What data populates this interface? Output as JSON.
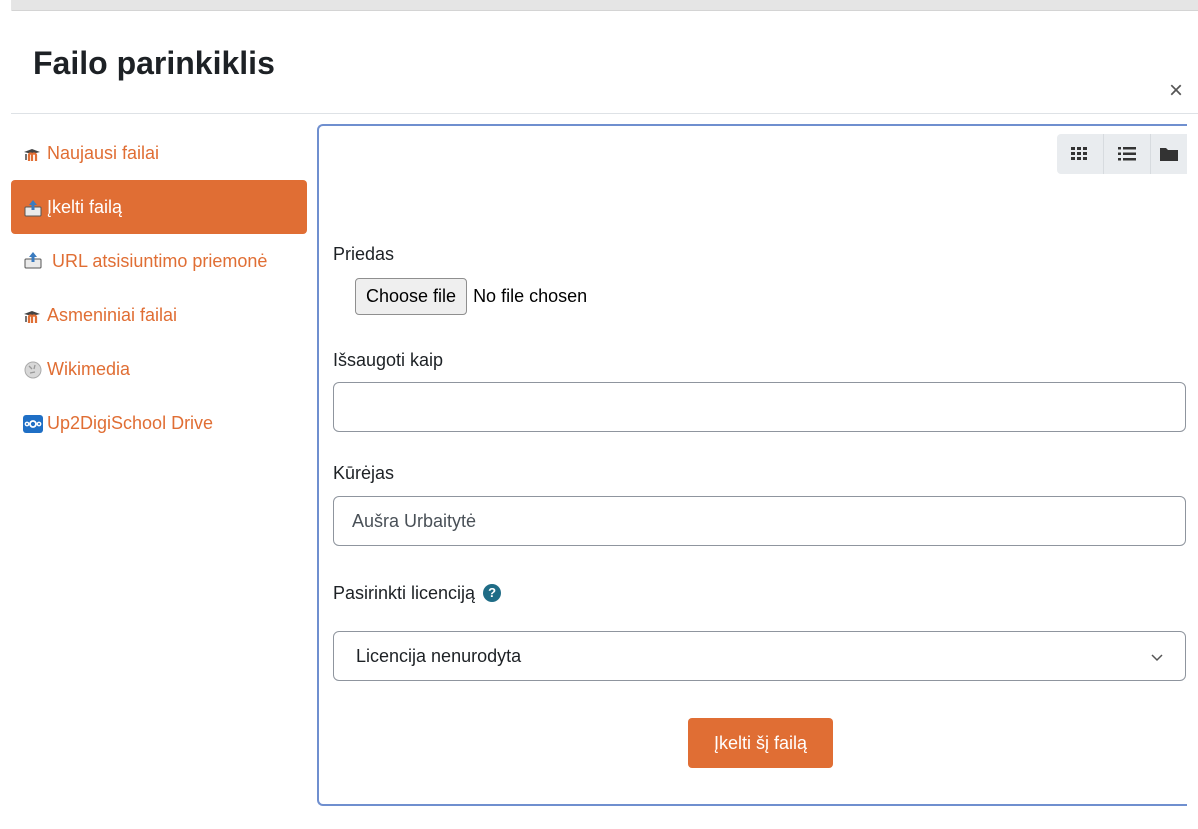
{
  "dialog": {
    "title": "Failo parinkiklis",
    "close_glyph": "×"
  },
  "sidebar": {
    "items": [
      {
        "label": "Naujausi failai",
        "icon": "moodle-icon",
        "active": false
      },
      {
        "label": "Įkelti failą",
        "icon": "upload-icon",
        "active": true
      },
      {
        "label": "URL atsisiuntimo priemonė",
        "icon": "url-download-icon",
        "active": false
      },
      {
        "label": "Asmeniniai failai",
        "icon": "moodle-icon",
        "active": false
      },
      {
        "label": "Wikimedia",
        "icon": "wikimedia-icon",
        "active": false
      },
      {
        "label": "Up2DigiSchool Drive",
        "icon": "nextcloud-icon",
        "active": false
      }
    ]
  },
  "viewbar": {
    "buttons": [
      "grid-view-icon",
      "list-view-icon",
      "folder-view-icon"
    ]
  },
  "form": {
    "attachment_label": "Priedas",
    "choose_file_label": "Choose file",
    "no_file_text": "No file chosen",
    "save_as_label": "Išsaugoti kaip",
    "save_as_value": "",
    "author_label": "Kūrėjas",
    "author_value": "Aušra Urbaitytė",
    "license_label": "Pasirinkti licenciją",
    "license_selected": "Licencija nenurodyta",
    "upload_button": "Įkelti šį failą"
  },
  "colors": {
    "accent": "#e06e34",
    "panel_border": "#6f8fcf",
    "help": "#1f6c86"
  }
}
